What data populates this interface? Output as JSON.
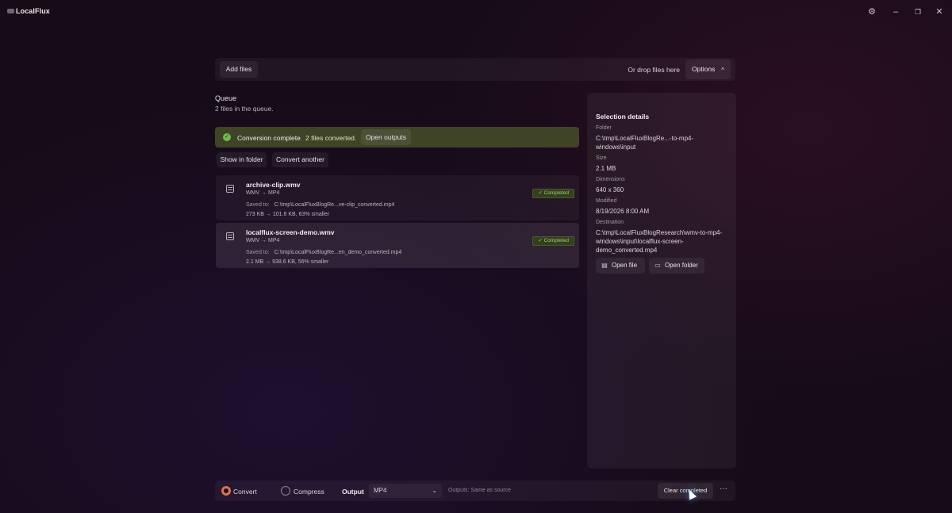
{
  "app": {
    "name": "LocalFlux",
    "icons": {
      "settings": "gear-icon",
      "minimize": "minimize-icon",
      "restore": "restore-icon",
      "close": "close-icon"
    }
  },
  "toolbar": {
    "add_files": "Add files",
    "drop_hint": "Or drop files here",
    "options": "Options",
    "options_chevron": "^"
  },
  "queue": {
    "title": "Queue",
    "count_text": "2 files in the queue."
  },
  "banner": {
    "check": "✓",
    "title": "Conversion complete",
    "message": "2 files converted.",
    "open_outputs": "Open outputs",
    "color": "#3f4426"
  },
  "actions": {
    "show_in_folder": "Show in folder",
    "convert_another": "Convert another"
  },
  "files": [
    {
      "name": "archive-clip.wmv",
      "format": "WMV → MP4",
      "saved_label": "Saved to:",
      "saved_path": "C:\\tmp\\LocalFluxBlogRe...ve-clip_converted.mp4",
      "size_text": "273 KB → 101.6 KB, 63% smaller",
      "status": "✓ Completed"
    },
    {
      "name": "localflux-screen-demo.wmv",
      "format": "WMV → MP4",
      "saved_label": "Saved to:",
      "saved_path": "C:\\tmp\\LocalFluxBlogRe...en_demo_converted.mp4",
      "size_text": "2.1 MB → 938.6 KB, 56% smaller",
      "status": "✓ Completed"
    }
  ],
  "details": {
    "title": "Selection details",
    "folder_label": "Folder",
    "folder_value": "C:\\tmp\\LocalFluxBlogRe...-to-mp4-windows\\input",
    "size_label": "Size",
    "size_value": "2.1 MB",
    "dimensions_label": "Dimensions",
    "dimensions_value": "640 x 360",
    "modified_label": "Modified",
    "modified_value": "8/19/2026 8:00 AM",
    "destination_label": "Destination",
    "destination_value": "C:\\tmp\\LocalFluxBlogResearch\\wmv-to-mp4-windows\\input\\localflux-screen-demo_converted.mp4",
    "open_file": "Open file",
    "open_folder": "Open folder"
  },
  "bottombar": {
    "convert": "Convert",
    "compress": "Compress",
    "mode_selected": "Convert",
    "output_label": "Output",
    "output_value": "MP4",
    "output_hint": "Outputs: Same as source",
    "clear_completed": "Clear completed",
    "more": "···",
    "accent": "#e46e51"
  }
}
